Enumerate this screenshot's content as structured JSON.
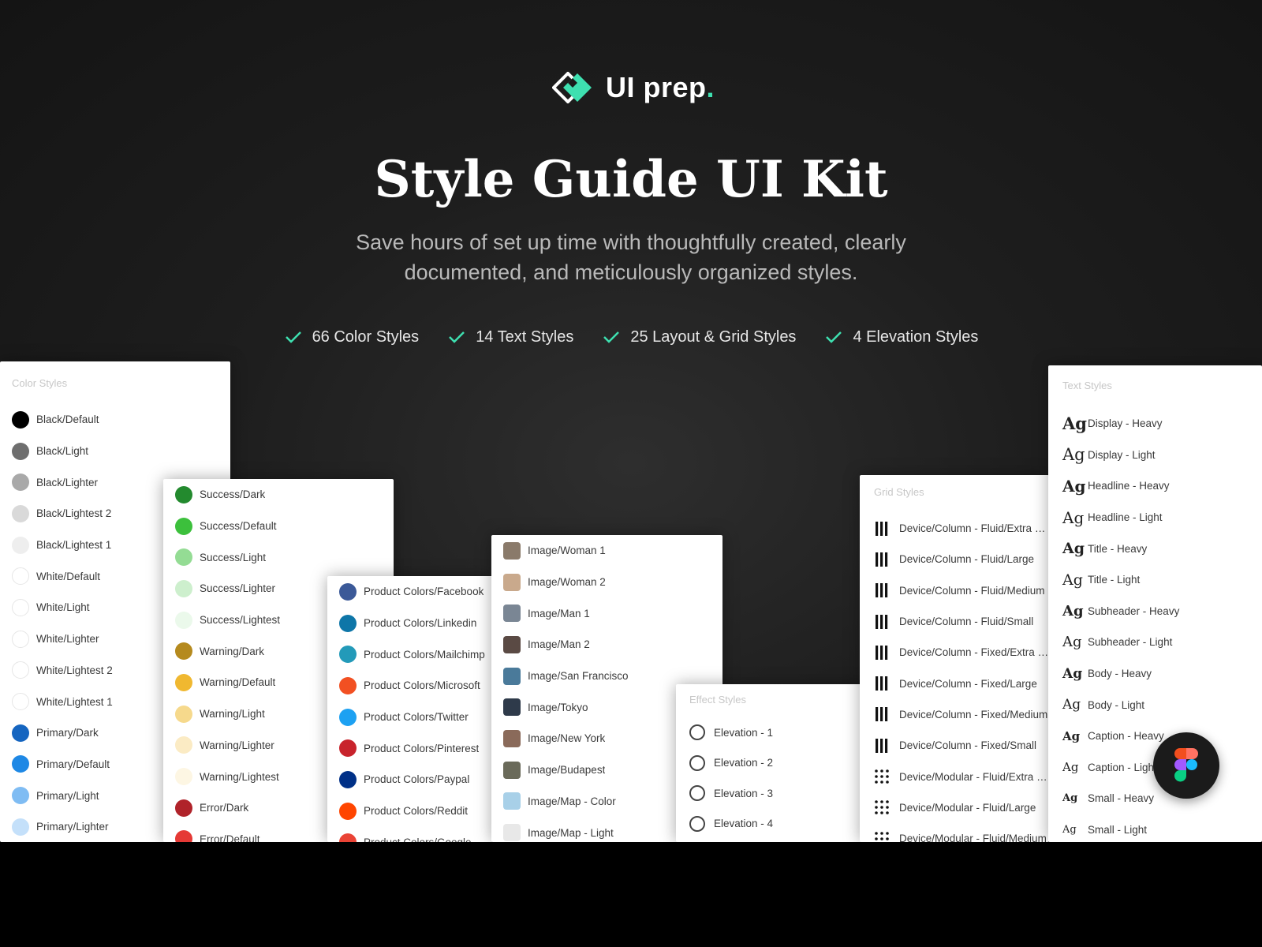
{
  "brand": {
    "name": "UI prep",
    "dot": ".",
    "accent": "#3ee0b0"
  },
  "hero": {
    "title": "Style Guide UI Kit",
    "subtitle": "Save hours of set up time with thoughtfully created, clearly documented, and meticulously organized styles.",
    "features": [
      "66 Color Styles",
      "14 Text Styles",
      "25 Layout & Grid Styles",
      "4 Elevation Styles"
    ]
  },
  "color_panel_1": {
    "title": "Color Styles",
    "items": [
      {
        "label": "Black/Default",
        "color": "#000000"
      },
      {
        "label": "Black/Light",
        "color": "#6e6e6e"
      },
      {
        "label": "Black/Lighter",
        "color": "#a9a9a9"
      },
      {
        "label": "Black/Lightest 2",
        "color": "#d9d9d9"
      },
      {
        "label": "Black/Lightest 1",
        "color": "#eeeeee"
      },
      {
        "label": "White/Default",
        "color": "#ffffff"
      },
      {
        "label": "White/Light",
        "color": "#ffffff"
      },
      {
        "label": "White/Lighter",
        "color": "#ffffff"
      },
      {
        "label": "White/Lightest 2",
        "color": "#ffffff"
      },
      {
        "label": "White/Lightest 1",
        "color": "#ffffff"
      },
      {
        "label": "Primary/Dark",
        "color": "#1565c0"
      },
      {
        "label": "Primary/Default",
        "color": "#1e88e5"
      },
      {
        "label": "Primary/Light",
        "color": "#7fbcf3"
      },
      {
        "label": "Primary/Lighter",
        "color": "#c4e0fa"
      }
    ]
  },
  "color_panel_2": {
    "items": [
      {
        "label": "Success/Dark",
        "color": "#238a2e"
      },
      {
        "label": "Success/Default",
        "color": "#3cc03c"
      },
      {
        "label": "Success/Light",
        "color": "#94dc94"
      },
      {
        "label": "Success/Lighter",
        "color": "#cdefcd"
      },
      {
        "label": "Success/Lightest",
        "color": "#ebf9eb"
      },
      {
        "label": "Warning/Dark",
        "color": "#b58a1e"
      },
      {
        "label": "Warning/Default",
        "color": "#f0b830"
      },
      {
        "label": "Warning/Light",
        "color": "#f6d98c"
      },
      {
        "label": "Warning/Lighter",
        "color": "#fbebc4"
      },
      {
        "label": "Warning/Lightest",
        "color": "#fdf6e3"
      },
      {
        "label": "Error/Dark",
        "color": "#b0232a"
      },
      {
        "label": "Error/Default",
        "color": "#e53935"
      }
    ]
  },
  "product_panel": {
    "items": [
      {
        "label": "Product Colors/Facebook",
        "color": "#3b5998"
      },
      {
        "label": "Product Colors/Linkedin",
        "color": "#0e76a8"
      },
      {
        "label": "Product Colors/Mailchimp",
        "color": "#239ab9"
      },
      {
        "label": "Product Colors/Microsoft",
        "color": "#f25022"
      },
      {
        "label": "Product Colors/Twitter",
        "color": "#1da1f2"
      },
      {
        "label": "Product Colors/Pinterest",
        "color": "#c8232c"
      },
      {
        "label": "Product Colors/Paypal",
        "color": "#003087"
      },
      {
        "label": "Product Colors/Reddit",
        "color": "#ff4500"
      },
      {
        "label": "Product Colors/Google",
        "color": "#ea4335"
      }
    ]
  },
  "image_panel": {
    "items": [
      {
        "label": "Image/Woman 1",
        "color": "#8a7a6a"
      },
      {
        "label": "Image/Woman 2",
        "color": "#c9a98c"
      },
      {
        "label": "Image/Man 1",
        "color": "#7a8694"
      },
      {
        "label": "Image/Man 2",
        "color": "#5a4a44"
      },
      {
        "label": "Image/San Francisco",
        "color": "#4a7a9a"
      },
      {
        "label": "Image/Tokyo",
        "color": "#2e3a4a"
      },
      {
        "label": "Image/New York",
        "color": "#8a6a5a"
      },
      {
        "label": "Image/Budapest",
        "color": "#6a6a5a"
      },
      {
        "label": "Image/Map - Color",
        "color": "#a8d0e8"
      },
      {
        "label": "Image/Map - Light",
        "color": "#e8e8e8"
      }
    ]
  },
  "effect_panel": {
    "title": "Effect Styles",
    "items": [
      "Elevation - 1",
      "Elevation - 2",
      "Elevation - 3",
      "Elevation - 4"
    ]
  },
  "grid_panel": {
    "title": "Grid Styles",
    "items": [
      {
        "label": "Device/Column - Fluid/Extra Large",
        "icon": "columns-icon"
      },
      {
        "label": "Device/Column - Fluid/Large",
        "icon": "columns-icon"
      },
      {
        "label": "Device/Column - Fluid/Medium",
        "icon": "columns-icon"
      },
      {
        "label": "Device/Column - Fluid/Small",
        "icon": "columns-icon"
      },
      {
        "label": "Device/Column - Fixed/Extra Large",
        "icon": "columns-icon"
      },
      {
        "label": "Device/Column - Fixed/Large",
        "icon": "columns-icon"
      },
      {
        "label": "Device/Column - Fixed/Medium",
        "icon": "columns-icon"
      },
      {
        "label": "Device/Column - Fixed/Small",
        "icon": "columns-icon"
      },
      {
        "label": "Device/Modular - Fluid/Extra Large",
        "icon": "modular-grid-icon"
      },
      {
        "label": "Device/Modular - Fluid/Large",
        "icon": "modular-grid-icon"
      },
      {
        "label": "Device/Modular - Fluid/Medium",
        "icon": "modular-grid-icon"
      }
    ]
  },
  "text_panel": {
    "title": "Text Styles",
    "glyph": "Ag",
    "items": [
      {
        "label": "Display - Heavy"
      },
      {
        "label": "Display - Light"
      },
      {
        "label": "Headline - Heavy"
      },
      {
        "label": "Headline - Light"
      },
      {
        "label": "Title - Heavy"
      },
      {
        "label": "Title - Light"
      },
      {
        "label": "Subheader - Heavy"
      },
      {
        "label": "Subheader - Light"
      },
      {
        "label": "Body - Heavy"
      },
      {
        "label": "Body - Light"
      },
      {
        "label": "Caption - Heavy"
      },
      {
        "label": "Caption - Light"
      },
      {
        "label": "Small - Heavy"
      },
      {
        "label": "Small - Light"
      }
    ]
  },
  "figma_button": {
    "icon": "figma-logo-icon"
  }
}
